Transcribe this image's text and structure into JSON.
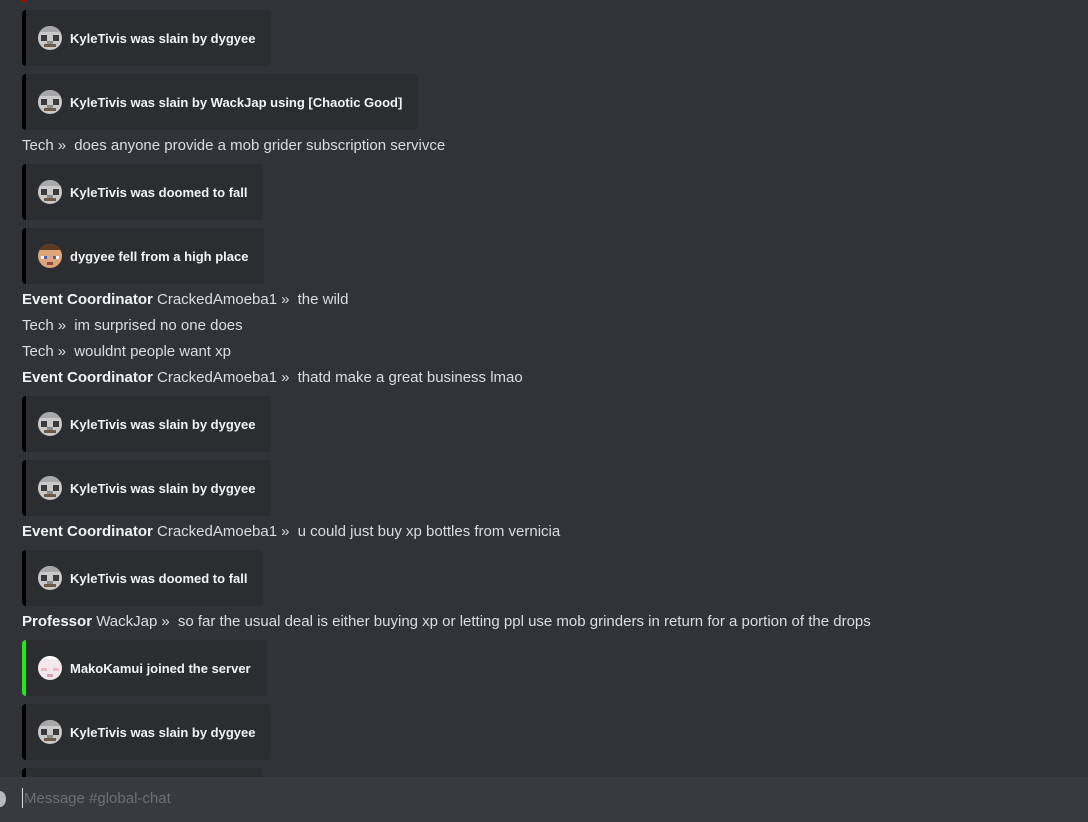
{
  "channel_input": {
    "placeholder": "Message #global-chat"
  },
  "icons": {
    "kyletivis_head": "skeleton-mob-head-icon",
    "dygyee_head": "steve-head-icon",
    "makokamui_head": "player-head-icon"
  },
  "colors": {
    "background": "#313338",
    "embed_bg": "#2b2d31",
    "embed_border_default": "#000000",
    "embed_border_join": "#1ee815",
    "input_bg": "#383a40"
  },
  "messages": [
    {
      "type": "embed",
      "text": "KyleTivis was slain by dygyee"
    },
    {
      "type": "embed",
      "text": "KyleTivis was slain by WackJap using [Chaotic Good]"
    },
    {
      "type": "chat",
      "role": "",
      "user": "Tech",
      "sep": "»",
      "text": "does anyone provide a mob grider subscription servivce"
    },
    {
      "type": "embed",
      "text": "KyleTivis was doomed to fall"
    },
    {
      "type": "embed",
      "text": "dygyee fell from a high place"
    },
    {
      "type": "chat",
      "role": "Event Coordinator",
      "user": "CrackedAmoeba1",
      "sep": "»",
      "text": "the wild"
    },
    {
      "type": "chat",
      "role": "",
      "user": "Tech",
      "sep": "»",
      "text": "im surprised no one does"
    },
    {
      "type": "chat",
      "role": "",
      "user": "Tech",
      "sep": "»",
      "text": "wouldnt people want xp"
    },
    {
      "type": "chat",
      "role": "Event Coordinator",
      "user": "CrackedAmoeba1",
      "sep": "»",
      "text": "thatd make a great business lmao"
    },
    {
      "type": "embed",
      "text": "KyleTivis was slain by dygyee"
    },
    {
      "type": "embed",
      "text": "KyleTivis was slain by dygyee"
    },
    {
      "type": "chat",
      "role": "Event Coordinator",
      "user": "CrackedAmoeba1",
      "sep": "»",
      "text": "u could just buy xp bottles from vernicia"
    },
    {
      "type": "embed",
      "text": "KyleTivis was doomed to fall"
    },
    {
      "type": "chat",
      "role": "Professor",
      "user": "WackJap",
      "sep": "»",
      "text": "so far the usual deal is either buying xp or letting ppl use mob grinders in return for a portion of the drops"
    },
    {
      "type": "embed",
      "text": "MakoKamui joined the server"
    },
    {
      "type": "embed",
      "text": "KyleTivis was slain by dygyee"
    }
  ]
}
